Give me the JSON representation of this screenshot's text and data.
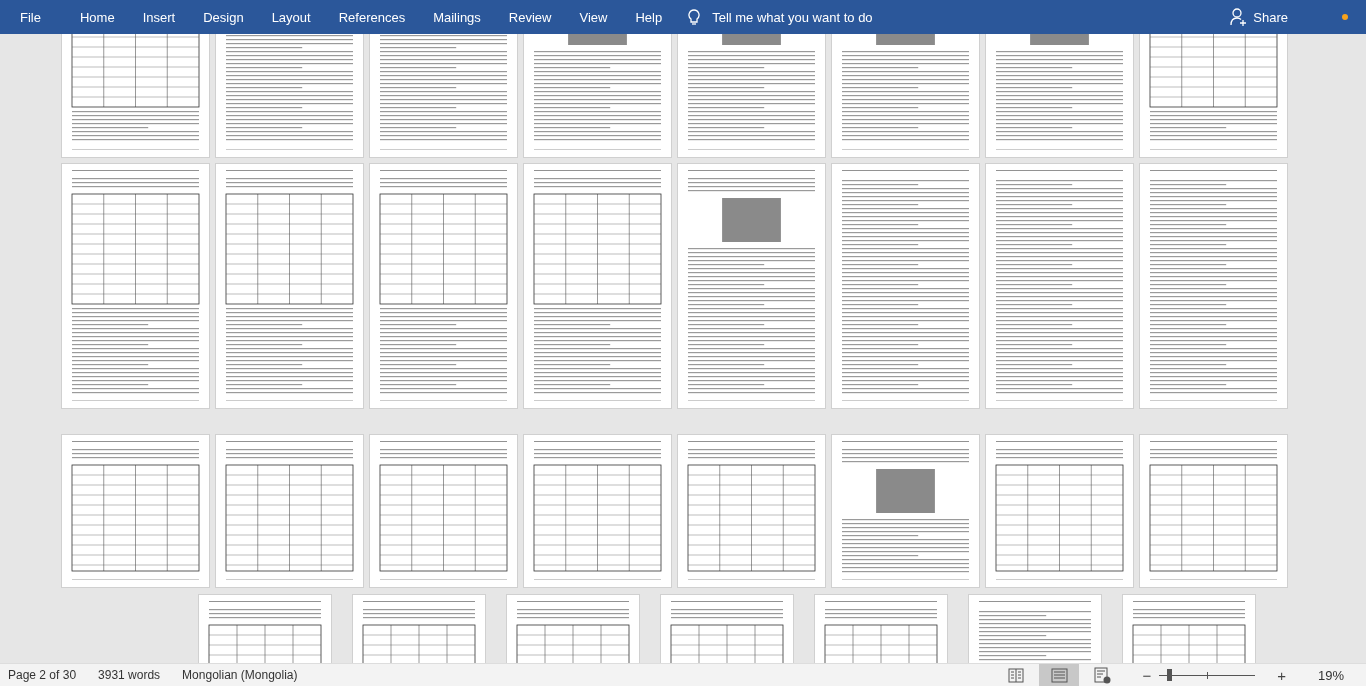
{
  "menu": [
    {
      "label": "File"
    },
    {
      "label": "Home"
    },
    {
      "label": "Insert"
    },
    {
      "label": "Design"
    },
    {
      "label": "Layout"
    },
    {
      "label": "References"
    },
    {
      "label": "Mailings"
    },
    {
      "label": "Review"
    },
    {
      "label": "View"
    },
    {
      "label": "Help"
    }
  ],
  "tell_me": {
    "placeholder": "Tell me what you want to do"
  },
  "share": {
    "label": "Share"
  },
  "page_rows": [
    {
      "kind": "cut",
      "pages": [
        {
          "kind": "table"
        },
        {
          "kind": "text"
        },
        {
          "kind": "text"
        },
        {
          "kind": "figure"
        },
        {
          "kind": "figure"
        },
        {
          "kind": "figure"
        },
        {
          "kind": "figure"
        },
        {
          "kind": "table"
        }
      ]
    },
    {
      "kind": "full",
      "pages": [
        {
          "kind": "table"
        },
        {
          "kind": "table"
        },
        {
          "kind": "table"
        },
        {
          "kind": "table"
        },
        {
          "kind": "figure"
        },
        {
          "kind": "text"
        },
        {
          "kind": "text"
        },
        {
          "kind": "text"
        }
      ]
    },
    {
      "kind": "short",
      "pages": [
        {
          "kind": "table"
        },
        {
          "kind": "table"
        },
        {
          "kind": "table"
        },
        {
          "kind": "table"
        },
        {
          "kind": "table"
        },
        {
          "kind": "figure"
        },
        {
          "kind": "table"
        },
        {
          "kind": "table"
        }
      ]
    },
    {
      "kind": "partial",
      "pages": [
        {
          "kind": "table"
        },
        {
          "kind": "table"
        },
        {
          "kind": "table"
        },
        {
          "kind": "table"
        },
        {
          "kind": "table"
        },
        {
          "kind": "text"
        },
        {
          "kind": "table"
        }
      ]
    }
  ],
  "status": {
    "page": "Page 2 of 30",
    "words": "3931 words",
    "language": "Mongolian (Mongolia)"
  },
  "views": [
    {
      "kind": "read",
      "selected": false
    },
    {
      "kind": "print",
      "selected": true
    },
    {
      "kind": "web",
      "selected": false
    }
  ],
  "zoom": {
    "minus": "−",
    "plus": "+",
    "level": 0.1,
    "value": "19%"
  }
}
